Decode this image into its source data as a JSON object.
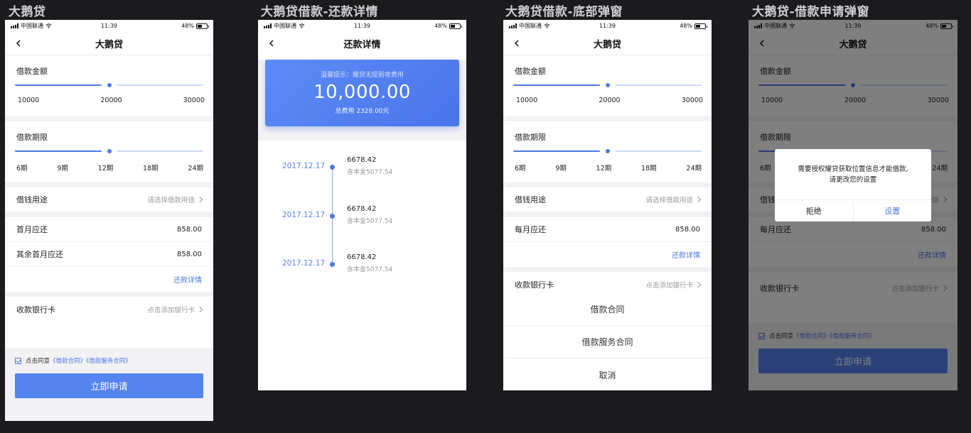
{
  "boards": [
    {
      "title": "大鹅贷"
    },
    {
      "title": "大鹅贷借款-还款详情"
    },
    {
      "title": "大鹅贷借款-底部弹窗"
    },
    {
      "title": "大鹅贷-借款申请弹窗"
    }
  ],
  "status": {
    "carrier": "中国联通",
    "time": "11:39",
    "battery": "48%"
  },
  "loan": {
    "nav_title": "大鹅贷",
    "amount_label": "借款金额",
    "amount_ticks": [
      "10000",
      "20000",
      "30000"
    ],
    "amount_value": 20000,
    "term_label": "借款期限",
    "term_ticks": [
      "6期",
      "9期",
      "12期",
      "18期",
      "24期"
    ],
    "term_value": "12期",
    "purpose_label": "借钱用途",
    "purpose_hint": "请选择借款用途",
    "first_month_label": "首月应还",
    "first_month_value": "858.00",
    "other_months_label": "其余首月应还",
    "other_months_value": "858.00",
    "monthly_label": "每月应还",
    "monthly_value": "858.00",
    "repay_detail_link": "还款详情",
    "bank_label": "收款银行卡",
    "bank_hint": "点击添加银行卡",
    "agree_prefix": "点击同意",
    "agree_contract": "《借款合同》",
    "agree_service": "《借款服务合同》",
    "apply_button": "立即申请"
  },
  "repayment": {
    "nav_title": "还款详情",
    "tip": "温馨提示：耀贷无提前收费用",
    "amount": "10,000.00",
    "total_fee": "总费用 2328.00元",
    "items": [
      {
        "date": "2017.12.17",
        "amount": "6678.42",
        "principal": "含本金5077.54"
      },
      {
        "date": "2017.12.17",
        "amount": "6678.42",
        "principal": "含本金5077.54"
      },
      {
        "date": "2017.12.17",
        "amount": "6678.42",
        "principal": "含本金5077.54"
      }
    ]
  },
  "sheet": {
    "options": [
      "借款合同",
      "借款服务合同",
      "取消"
    ]
  },
  "dialog": {
    "message_line1": "需要授权耀贷获取位置信息才能借款,",
    "message_line2": "请更改您的设置",
    "refuse": "拒绝",
    "settings": "设置"
  },
  "colors": {
    "accent": "#4a79e6",
    "button": "#5584f0",
    "background": "#1b1b1d"
  }
}
